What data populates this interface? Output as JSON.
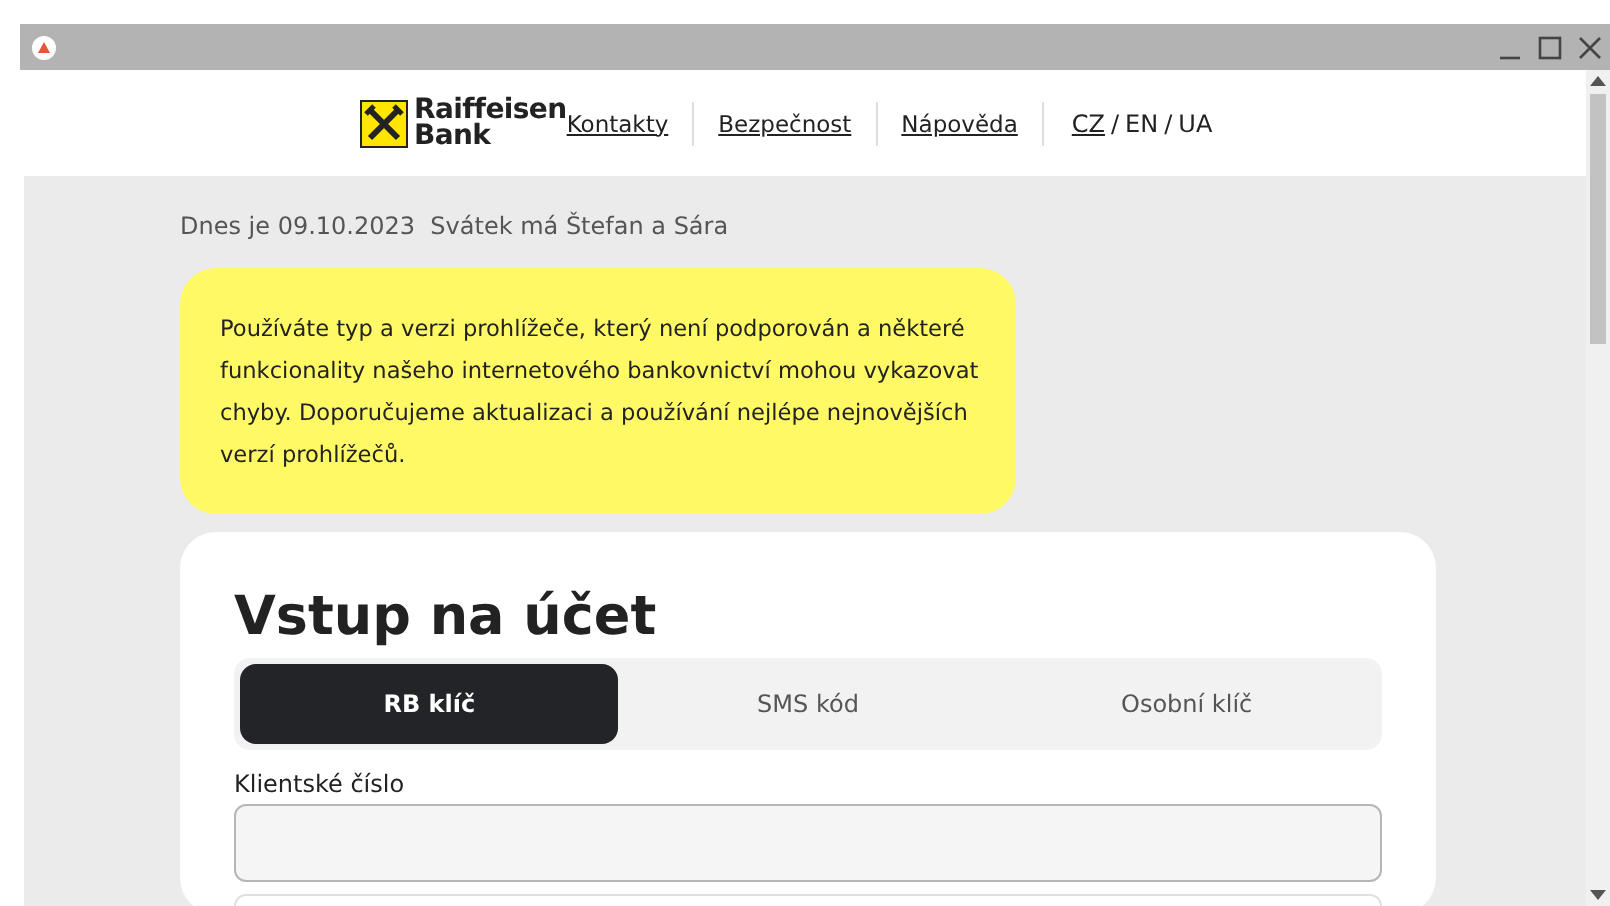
{
  "header": {
    "logo_text": [
      "Raiffeisen",
      "Bank"
    ],
    "links": [
      {
        "label": "Kontakty"
      },
      {
        "label": "Bezpečnost"
      },
      {
        "label": "Nápověda"
      }
    ],
    "language_separator": "/",
    "languages": [
      {
        "label": "CZ",
        "selected": true
      },
      {
        "label": "EN",
        "selected": false
      },
      {
        "label": "UA",
        "selected": false
      }
    ]
  },
  "date_line": "Dnes je 09.10.2023  Svátek má Štefan a Sára",
  "warning": "Používáte typ a verzi prohlížeče, který není podporován a některé funkcionality našeho internetového bankovnictví mohou vykazovat chyby. Doporučujeme aktualizaci a používání nejlépe nejnovějších verzí prohlížečů.",
  "login": {
    "title": "Vstup na účet",
    "tabs": [
      {
        "label": "RB klíč",
        "selected": true
      },
      {
        "label": "SMS kód",
        "selected": false
      },
      {
        "label": "Osobní klíč",
        "selected": false
      }
    ],
    "fields": [
      {
        "label": "Klientské číslo"
      }
    ]
  }
}
